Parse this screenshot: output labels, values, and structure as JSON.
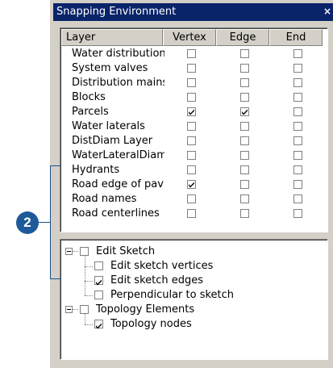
{
  "window": {
    "title": "Snapping Environment",
    "close_glyph": "×"
  },
  "table": {
    "headers": [
      "Layer",
      "Vertex",
      "Edge",
      "End"
    ],
    "rows": [
      {
        "name": "Water distribution r",
        "vertex": false,
        "edge": false,
        "end": false
      },
      {
        "name": "System valves",
        "vertex": false,
        "edge": false,
        "end": false
      },
      {
        "name": "Distribution mains",
        "vertex": false,
        "edge": false,
        "end": false
      },
      {
        "name": "Blocks",
        "vertex": false,
        "edge": false,
        "end": false
      },
      {
        "name": "Parcels",
        "vertex": true,
        "edge": true,
        "end": false
      },
      {
        "name": "Water laterals",
        "vertex": false,
        "edge": false,
        "end": false
      },
      {
        "name": "DistDiam Layer",
        "vertex": false,
        "edge": false,
        "end": false
      },
      {
        "name": "WaterLateralDiame",
        "vertex": false,
        "edge": false,
        "end": false
      },
      {
        "name": "Hydrants",
        "vertex": false,
        "edge": false,
        "end": false
      },
      {
        "name": "Road  edge of pav",
        "vertex": true,
        "edge": false,
        "end": false
      },
      {
        "name": "Road names",
        "vertex": false,
        "edge": false,
        "end": false
      },
      {
        "name": "Road centerlines",
        "vertex": false,
        "edge": false,
        "end": false
      }
    ]
  },
  "tree": {
    "groups": [
      {
        "label": "Edit Sketch",
        "checked": false,
        "expanded": true,
        "children": [
          {
            "label": "Edit sketch vertices",
            "checked": false
          },
          {
            "label": "Edit sketch edges",
            "checked": true
          },
          {
            "label": "Perpendicular to sketch",
            "checked": false
          }
        ]
      },
      {
        "label": "Topology Elements",
        "checked": false,
        "expanded": true,
        "children": [
          {
            "label": "Topology nodes",
            "checked": true
          }
        ]
      }
    ]
  },
  "callout": {
    "number": "2"
  },
  "colors": {
    "titlebar": "#0a246a",
    "callout": "#1e5a99",
    "dialog_bg": "#d4d0c8"
  }
}
